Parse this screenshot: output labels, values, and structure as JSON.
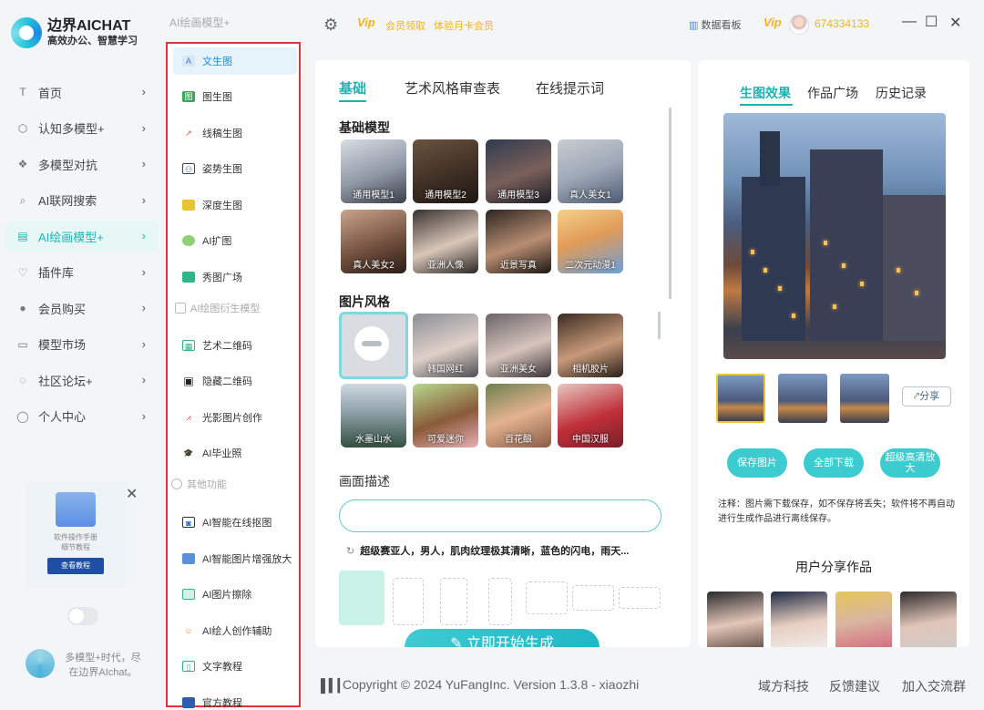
{
  "app": {
    "title": "边界AICHAT",
    "subtitle": "高效办公、智慧学习"
  },
  "topbar": {
    "section_label": "AI绘画模型+",
    "settings_icon": "gear-icon",
    "vip_badge": "Vip",
    "member_link": "会员领取",
    "trial_link": "体验月卡会员",
    "dashboard_label": "数据看板",
    "vip_badge2": "Vip",
    "user_id": "674334133"
  },
  "nav": {
    "items": [
      {
        "label": "首页",
        "icon": "T"
      },
      {
        "label": "认知多模型+",
        "icon": "⬡"
      },
      {
        "label": "多模型对抗",
        "icon": "❖"
      },
      {
        "label": "AI联网搜索",
        "icon": "⌕"
      },
      {
        "label": "AI绘画模型+",
        "icon": "▤"
      },
      {
        "label": "插件库",
        "icon": "♡"
      },
      {
        "label": "会员购买",
        "icon": "●"
      },
      {
        "label": "模型市场",
        "icon": "▭"
      },
      {
        "label": "社区论坛+",
        "icon": "◌"
      },
      {
        "label": "个人中心",
        "icon": "◯"
      }
    ]
  },
  "promo": {
    "line1": "软件操作手册",
    "line2": "细节教程",
    "button": "查看教程"
  },
  "footer_left": {
    "line1": "多模型+时代，尽",
    "line2": "在边界AIchat。"
  },
  "submenu": {
    "group1": "AI绘画模型+",
    "items1": [
      "文生图",
      "图生图",
      "线稿生图",
      "姿势生图",
      "深度生图",
      "AI扩图",
      "秀图广场"
    ],
    "group2": "AI绘图衍生模型",
    "items2": [
      "艺术二维码",
      "隐藏二维码",
      "光影图片创作",
      "AI毕业照"
    ],
    "group3": "其他功能",
    "items3": [
      "AI智能在线抠图",
      "AI智能图片增强放大",
      "AI图片擦除",
      "AI绘人创作辅助",
      "文字教程",
      "官方教程"
    ]
  },
  "main": {
    "tabs": [
      "基础",
      "艺术风格审查表",
      "在线提示词"
    ],
    "section_models": "基础模型",
    "models": [
      "通用模型1",
      "通用模型2",
      "通用模型3",
      "真人美女1",
      "真人美女2",
      "亚洲人像",
      "近景写真",
      "二次元动漫1"
    ],
    "section_styles": "图片风格",
    "styles": [
      "",
      "韩国网红",
      "亚洲美女",
      "相机胶片",
      "水墨山水",
      "可爱迷你",
      "百花酿",
      "中国汉服"
    ],
    "desc_label": "画面描述",
    "desc_input_value": "",
    "prompt_example": "超级赛亚人，男人，肌肉纹理极其清晰，蓝色的闪电，雨天...",
    "generate_button": "立即开始生成"
  },
  "right": {
    "tabs": [
      "生图效果",
      "作品广场",
      "历史记录"
    ],
    "share_button": "分享",
    "save_button": "保存图片",
    "download_button": "全部下载",
    "upscale_button": "超级高清放大",
    "note": "注释：图片需下载保存，如不保存将丢失；软件将不再自动进行生成作品进行离线保存。",
    "share_title": "用户分享作品"
  },
  "footer": {
    "copyright": "Copyright © 2024 YuFangInc. Version 1.3.8 - xiaozhi",
    "links": [
      "域方科技",
      "反馈建议",
      "加入交流群"
    ]
  }
}
